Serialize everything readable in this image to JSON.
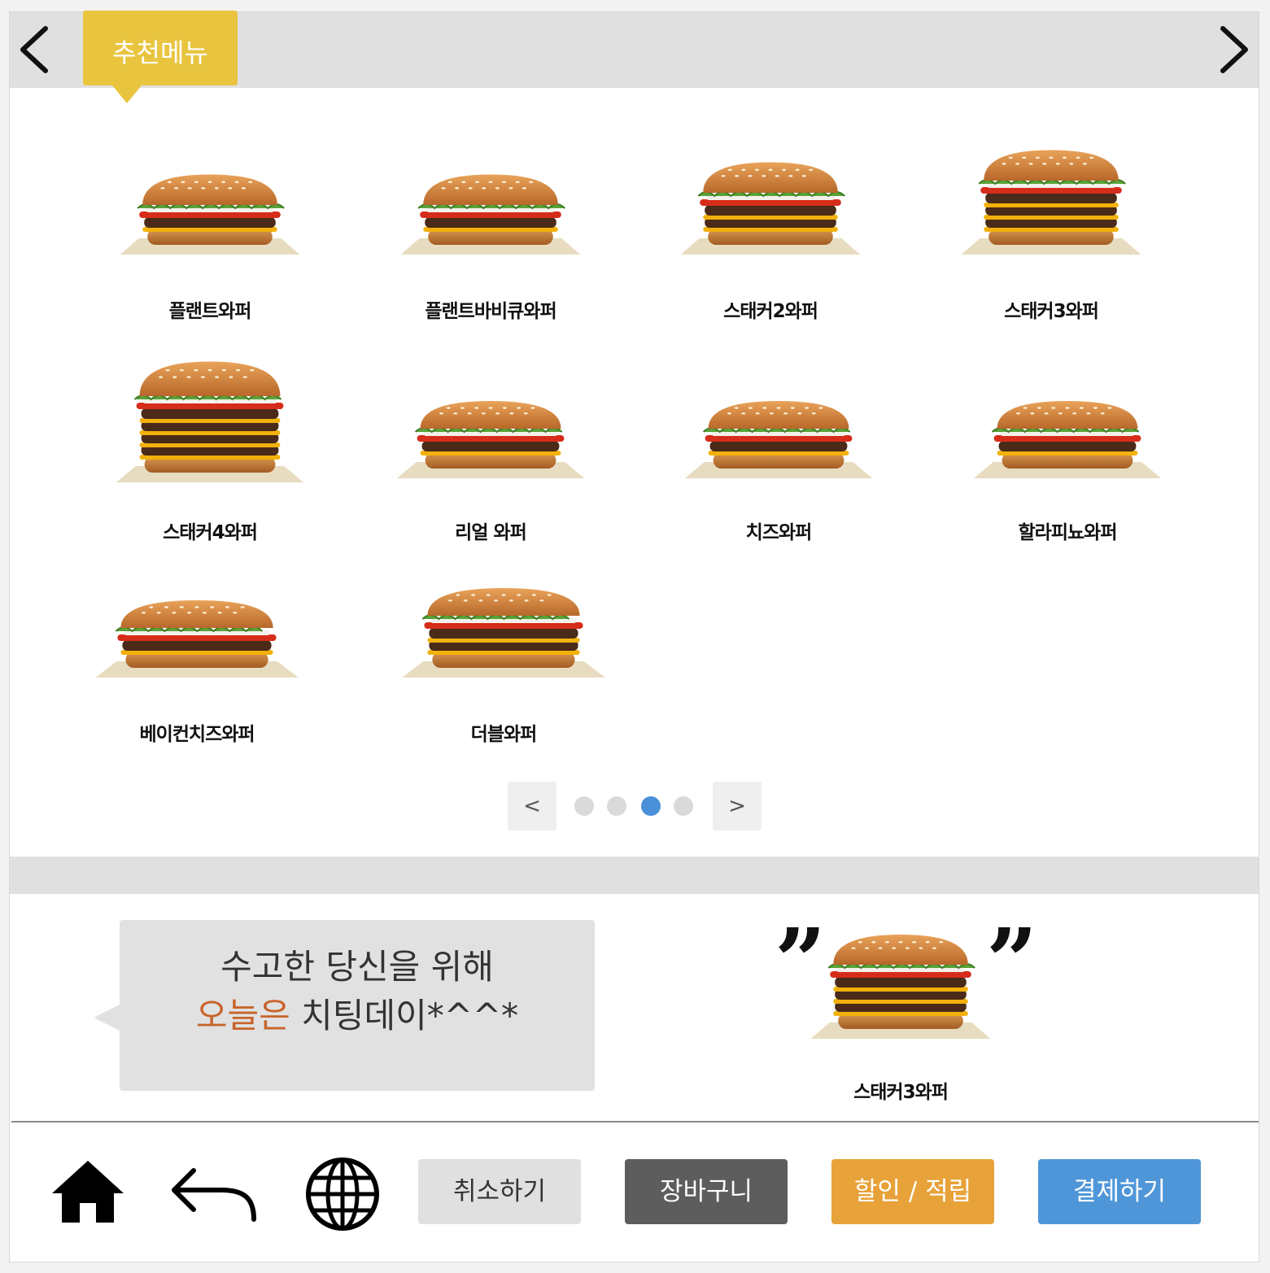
{
  "header": {
    "tab_label": "추천메뉴"
  },
  "menu_items": [
    {
      "name": "플랜트와퍼"
    },
    {
      "name": "플랜트바비큐와퍼"
    },
    {
      "name": "스태커2와퍼"
    },
    {
      "name": "스태커3와퍼"
    },
    {
      "name": "스태커4와퍼"
    },
    {
      "name": "리얼 와퍼"
    },
    {
      "name": "치즈와퍼"
    },
    {
      "name": "할라피뇨와퍼"
    },
    {
      "name": "베이컨치즈와퍼"
    },
    {
      "name": "더블와퍼"
    }
  ],
  "pager": {
    "prev_label": "<",
    "next_label": ">",
    "page_count": 4,
    "current_page": 3,
    "active_color": "#4a90d9"
  },
  "promo": {
    "line1": "수고한 당신을 위해",
    "line2_accent": "오늘은",
    "line2_rest": " 치팅데이*^^*",
    "accent_color": "#c8642a"
  },
  "featured": {
    "open_quote": "”",
    "close_quote": "”",
    "name": "스태커3와퍼"
  },
  "icons": {
    "home": "home-icon",
    "back": "back-arrow-icon",
    "language": "globe-icon"
  },
  "actions": {
    "cancel": "취소하기",
    "cart": "장바구니",
    "discount": "할인 / 적립",
    "pay": "결제하기"
  },
  "colors": {
    "tab": "#e9c43f",
    "cancel_bg": "#e0e0e0",
    "cart_bg": "#5d5d5d",
    "discount_bg": "#e8a23a",
    "pay_bg": "#4f96d8"
  }
}
